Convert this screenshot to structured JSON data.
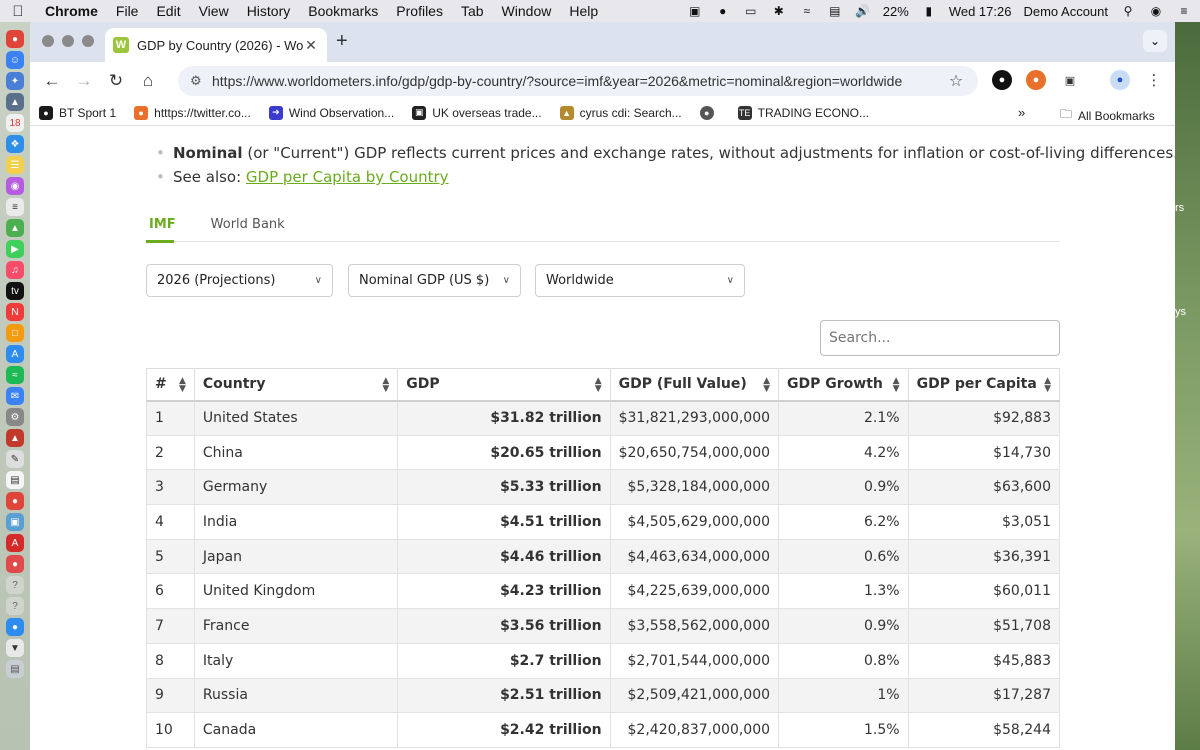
{
  "menubar": {
    "app": "Chrome",
    "items": [
      "File",
      "Edit",
      "View",
      "History",
      "Bookmarks",
      "Profiles",
      "Tab",
      "Window",
      "Help"
    ],
    "battery": "22%",
    "clock": "Wed 17:26",
    "account": "Demo Account"
  },
  "browser": {
    "tab_title": "GDP by Country (2026) - Wo",
    "tab_favicon": "W",
    "url": "https://www.worldometers.info/gdp/gdp-by-country/?source=imf&year=2026&metric=nominal&region=worldwide",
    "bookmarks": [
      {
        "label": "BT Sport 1",
        "color": "#1a1a1a"
      },
      {
        "label": "htttps://twitter.co...",
        "color": "#e8702a"
      },
      {
        "label": "Wind Observation...",
        "color": "#3b3bd0"
      },
      {
        "label": "UK overseas trade...",
        "color": "#222222"
      },
      {
        "label": "cyrus cdi: Search...",
        "color": "#b38a2e"
      },
      {
        "label": "",
        "color": "#555555"
      },
      {
        "label": "TRADING ECONO...",
        "color": "#333333"
      }
    ],
    "all_bookmarks": "All Bookmarks"
  },
  "content": {
    "bullet1_bold": "Nominal",
    "bullet1_rest": " (or \"Current\") GDP reflects current prices and exchange rates, without adjustments for inflation or cost-of-living differences.",
    "bullet2_prefix": "See also: ",
    "bullet2_link": "GDP per Capita by Country",
    "source_tabs": [
      "IMF",
      "World Bank"
    ],
    "filters": {
      "year": "2026 (Projections)",
      "metric": "Nominal GDP (US $)",
      "region": "Worldwide"
    },
    "search_placeholder": "Search..."
  },
  "table": {
    "headers": [
      "#",
      "Country",
      "GDP",
      "GDP (Full Value)",
      "GDP Growth",
      "GDP per Capita"
    ],
    "rows": [
      [
        "1",
        "United States",
        "$31.82 trillion",
        "$31,821,293,000,000",
        "2.1%",
        "$92,883"
      ],
      [
        "2",
        "China",
        "$20.65 trillion",
        "$20,650,754,000,000",
        "4.2%",
        "$14,730"
      ],
      [
        "3",
        "Germany",
        "$5.33 trillion",
        "$5,328,184,000,000",
        "0.9%",
        "$63,600"
      ],
      [
        "4",
        "India",
        "$4.51 trillion",
        "$4,505,629,000,000",
        "6.2%",
        "$3,051"
      ],
      [
        "5",
        "Japan",
        "$4.46 trillion",
        "$4,463,634,000,000",
        "0.6%",
        "$36,391"
      ],
      [
        "6",
        "United Kingdom",
        "$4.23 trillion",
        "$4,225,639,000,000",
        "1.3%",
        "$60,011"
      ],
      [
        "7",
        "France",
        "$3.56 trillion",
        "$3,558,562,000,000",
        "0.9%",
        "$51,708"
      ],
      [
        "8",
        "Italy",
        "$2.7 trillion",
        "$2,701,544,000,000",
        "0.8%",
        "$45,883"
      ],
      [
        "9",
        "Russia",
        "$2.51 trillion",
        "$2,509,421,000,000",
        "1%",
        "$17,287"
      ],
      [
        "10",
        "Canada",
        "$2.42 trillion",
        "$2,420,837,000,000",
        "1.5%",
        "$58,244"
      ]
    ]
  },
  "desktop_side_text": [
    "rs",
    "ys"
  ]
}
